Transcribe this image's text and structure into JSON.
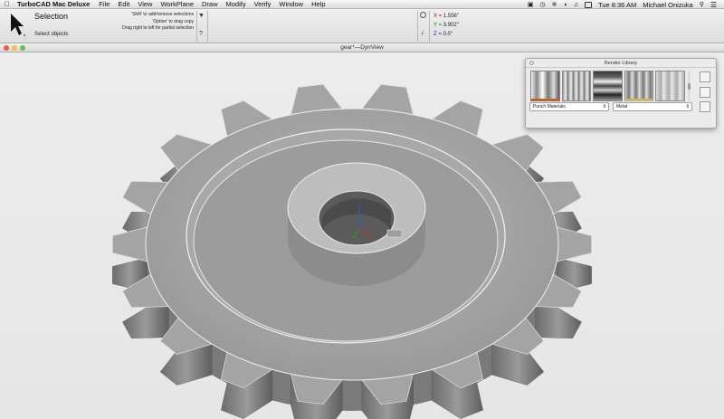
{
  "menubar": {
    "app_name": "TurboCAD Mac Deluxe",
    "menus": [
      "File",
      "Edit",
      "View",
      "WorkPlane",
      "Draw",
      "Modify",
      "Verify",
      "Window",
      "Help"
    ],
    "clock": "Tue 8:36 AM",
    "user": "Michael Onizuka"
  },
  "toolbar": {
    "tool_title": "Selection",
    "tool_sub": "Select objects",
    "hints": [
      "'Shift' to add/remove selections",
      "'Option' to drag copy",
      "Drag right to left for partial selection"
    ],
    "btn_pin": "▼",
    "btn_help": "?",
    "btn_info": "i",
    "coords": {
      "x_label": "X =",
      "x": "1.556\"",
      "y_label": "Y =",
      "y": "3.902\"",
      "z_label": "Z =",
      "z": "0.0\""
    }
  },
  "window": {
    "title": "gear*—DynView"
  },
  "render_library": {
    "title": "Render Library",
    "category": "Punch Materials",
    "material": "Metal"
  },
  "colors": {
    "close": "#ee5a52",
    "minimize": "#f5bd4f",
    "zoom": "#5fc454",
    "gear": "#8e8e8e",
    "accent": "#c00000"
  }
}
